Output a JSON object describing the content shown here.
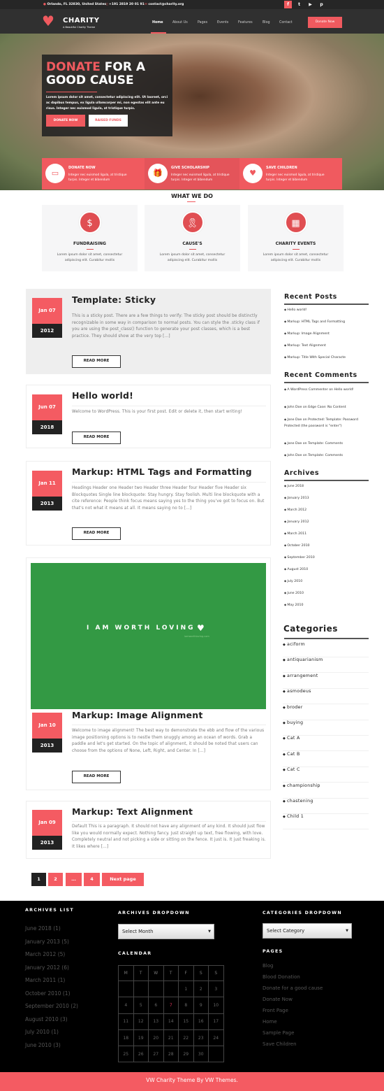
{
  "topbar": {
    "address": "Orlando, FL 32830, United States",
    "phone": "+191 2819 20 01 91",
    "email": "contact@charity.org",
    "social": [
      "f",
      "t",
      "▶",
      "p"
    ]
  },
  "header": {
    "logo": "CHARITY",
    "tagline": "A Beautiful Charity Theme",
    "nav": [
      "Home",
      "About Us",
      "Pages",
      "Events",
      "Features",
      "Blog",
      "Contact"
    ],
    "donate": "Donate Now"
  },
  "hero": {
    "title_accent": "DONATE",
    "title_rest": " FOR A GOOD CAUSE",
    "text": "Lorem ipsum dolor sit amet, consectetur adipiscing elit. Ut laoreet, orci ac dapibus tempus, ex ligula ullamcorper mi, non egestas elit ante eu risus. Integer nec euismod ligula, at tristique turpis.",
    "btn1": "DONATE NOW",
    "btn2": "RAISED FUNDS",
    "features": [
      {
        "icon": "wallet-icon",
        "title": "DONATE NOW",
        "text": "Integer nec euismod ligula, at tristique turpis. Integer et bibendum"
      },
      {
        "icon": "gift-icon",
        "title": "GIVE SCHOLARSHIP",
        "text": "Integer nec euismod ligula, at tristique turpis. Integer et bibendum"
      },
      {
        "icon": "heartbeat-icon",
        "title": "SAVE CHILDREN",
        "text": "Integer nec euismod ligula, at tristique turpis. Integer et bibendum"
      }
    ]
  },
  "what_we_do": {
    "title": "WHAT WE DO",
    "cards": [
      {
        "icon": "hand-dollar-icon",
        "title": "FUNDRAISING",
        "text": "Lorem ipsum dolor sit amet, consectetur adipiscing elit. Curabitur mollis"
      },
      {
        "icon": "ribbon-icon",
        "title": "CAUSE'S",
        "text": "Lorem ipsum dolor sit amet, consectetur adipiscing elit. Curabitur mollis"
      },
      {
        "icon": "calendar-icon",
        "title": "CHARITY EVENTS",
        "text": "Lorem ipsum dolor sit amet, consectetur adipiscing elit. Curabitur mollis"
      }
    ]
  },
  "read_more": "READ MORE",
  "posts": [
    {
      "month": "Jan 07",
      "year": "2012",
      "title": "Template: Sticky",
      "excerpt": "This is a sticky post. There are a few things to verify: The sticky post should be distinctly recognizable in some way in comparison to normal posts. You can style the .sticky class if you are using the post_class() function to generate your post classes, which is a best practice. They should show at the very top […]"
    },
    {
      "month": "Jun 07",
      "year": "2018",
      "title": "Hello world!",
      "excerpt": "Welcome to WordPress. This is your first post. Edit or delete it, then start writing!"
    },
    {
      "month": "Jan 11",
      "year": "2013",
      "title": "Markup: HTML Tags and Formatting",
      "excerpt": "Headings Header one Header two Header three Header four Header five Header six Blockquotes Single line blockquote: Stay hungry. Stay foolish. Multi line blockquote with a cite reference: People think focus means saying yes to the thing you've got to focus on. But that's not what it means at all. It means saying no to […]"
    },
    {
      "month": "Jan 10",
      "year": "2013",
      "title": "Markup: Image Alignment",
      "image_text": "I AM WORTH LOVING",
      "image_sub": "iamworthloving.com",
      "excerpt": "Welcome to image alignment! The best way to demonstrate the ebb and flow of the various image positioning options is to nestle them snuggly among an ocean of words. Grab a paddle and let's get started. On the topic of alignment, it should be noted that users can choose from the options of None, Left, Right, and Center. In […]"
    },
    {
      "month": "Jan 09",
      "year": "2013",
      "title": "Markup: Text Alignment",
      "excerpt": "Default This is a paragraph. It should not have any alignment of any kind. It should just flow like you would normally expect. Nothing fancy. Just straight up text, free flowing, with love. Completely neutral and not picking a side or sitting on the fence. It just is. It just freaking is. It likes where […]"
    }
  ],
  "pagination": [
    "1",
    "2",
    "…",
    "4",
    "Next page"
  ],
  "sidebar": {
    "recent_posts_title": "Recent Posts",
    "recent_posts": [
      "Hello world!",
      "Markup: HTML Tags and Formatting",
      "Markup: Image Alignment",
      "Markup: Text Alignment",
      "Markup: Title With Special Characte"
    ],
    "recent_comments_title": "Recent Comments",
    "recent_comments": [
      "A WordPress Commenter on Hello world!",
      "John Doe on Edge Case: No Content",
      "Jane Doe on Protected: Template: Password Protected (the password is \"enter\")",
      "Jane Doe on Template: Comments",
      "John Doe on Template: Comments"
    ],
    "archives_title": "Archives",
    "archives": [
      "June 2018",
      "January 2013",
      "March 2012",
      "January 2012",
      "March 2011",
      "October 2010",
      "September 2010",
      "August 2010",
      "July 2010",
      "June 2010",
      "May 2010"
    ],
    "categories_title": "Categories",
    "categories": [
      "aciform",
      "antiquarianism",
      "arrangement",
      "asmodeus",
      "broder",
      "buying",
      "Cat A",
      "Cat B",
      "Cat C",
      "championship",
      "chastening",
      "Child 1"
    ]
  },
  "footer": {
    "archives_list_title": "ARCHIVES LIST",
    "archives_list": [
      "June 2018 (1)",
      "January 2013 (5)",
      "March 2012 (5)",
      "January 2012 (6)",
      "March 2011 (1)",
      "October 2010 (1)",
      "September 2010 (2)",
      "August 2010 (3)",
      "July 2010 (1)",
      "June 2010 (3)"
    ],
    "archives_dropdown_title": "ARCHIVES DROPDOWN",
    "select_month": "Select Month",
    "calendar_title": "CALENDAR",
    "weekdays": [
      "M",
      "T",
      "W",
      "T",
      "F",
      "S",
      "S"
    ],
    "calendar_rows": [
      [
        "",
        "",
        "",
        "",
        "1",
        "2",
        "3"
      ],
      [
        "4",
        "5",
        "6",
        "7",
        "8",
        "9",
        "10"
      ],
      [
        "11",
        "12",
        "13",
        "14",
        "15",
        "16",
        "17"
      ],
      [
        "18",
        "19",
        "20",
        "21",
        "22",
        "23",
        "24"
      ],
      [
        "25",
        "26",
        "27",
        "28",
        "29",
        "30",
        ""
      ]
    ],
    "today": "7",
    "categories_dropdown_title": "CATEGORIES DROPDOWN",
    "select_category": "Select Category",
    "pages_title": "PAGES",
    "pages": [
      "Blog",
      "Blood Donation",
      "Donate for a good cause",
      "Donate Now",
      "Front Page",
      "Home",
      "Sample Page",
      "Save Children"
    ]
  },
  "copyright": "VW Charity Theme By VW Themes.",
  "colors": {
    "accent": "#f05a5f",
    "dark": "#262626",
    "footer": "#000000",
    "image_green": "#339944"
  }
}
